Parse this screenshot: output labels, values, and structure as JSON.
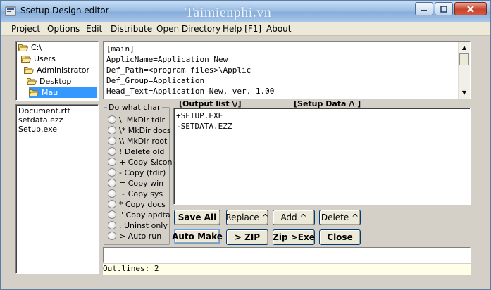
{
  "window": {
    "title": "Ssetup Design editor",
    "watermark": "Taimienphi.vn"
  },
  "menu": [
    "Project",
    "Options",
    "Edit",
    "Distribute",
    "Open Directory",
    "Help [F1]",
    "About"
  ],
  "directory_tree": [
    {
      "label": "C:\\",
      "selected": false
    },
    {
      "label": "Users",
      "selected": false
    },
    {
      "label": "Administrator",
      "selected": false
    },
    {
      "label": "Desktop",
      "selected": false
    },
    {
      "label": "Mau",
      "selected": true
    }
  ],
  "files": [
    "Document.rtf",
    "setdata.ezz",
    "Setup.exe"
  ],
  "editor_lines": [
    "[main]",
    "ApplicName=Application New",
    "Def_Path=<program files>\\Applic",
    "Def_Group=Application",
    "Head_Text=Application New, ver. 1.00"
  ],
  "do_what": {
    "title": "Do what char",
    "options": [
      "\\. MkDir tdir",
      "\\* MkDir docs",
      "\\\\ MkDir root",
      "! Delete old",
      "+ Copy &icon",
      "- Copy (tdir)",
      "= Copy win",
      "~ Copy sys",
      "* Copy docs",
      "'' Copy apdta",
      ". Uninst only",
      "> Auto run"
    ]
  },
  "output": {
    "list_header": "[Output list \\/]",
    "data_header": "[Setup Data /\\ ]",
    "lines": [
      "+SETUP.EXE",
      "-SETDATA.EZZ"
    ]
  },
  "buttons": {
    "save_all": "Save All",
    "replace": "Replace ^",
    "add": "Add ^",
    "delete": "Delete ^",
    "auto_make": "Auto Make",
    "zip": "> ZIP",
    "zip_exe": "Zip >Exe",
    "close": "Close"
  },
  "status": {
    "input_value": "",
    "text": "Out.lines: 2"
  },
  "colors": {
    "selection": "#3399ff",
    "folder": "#f5d66b",
    "status_bg": "#ffffe8"
  }
}
